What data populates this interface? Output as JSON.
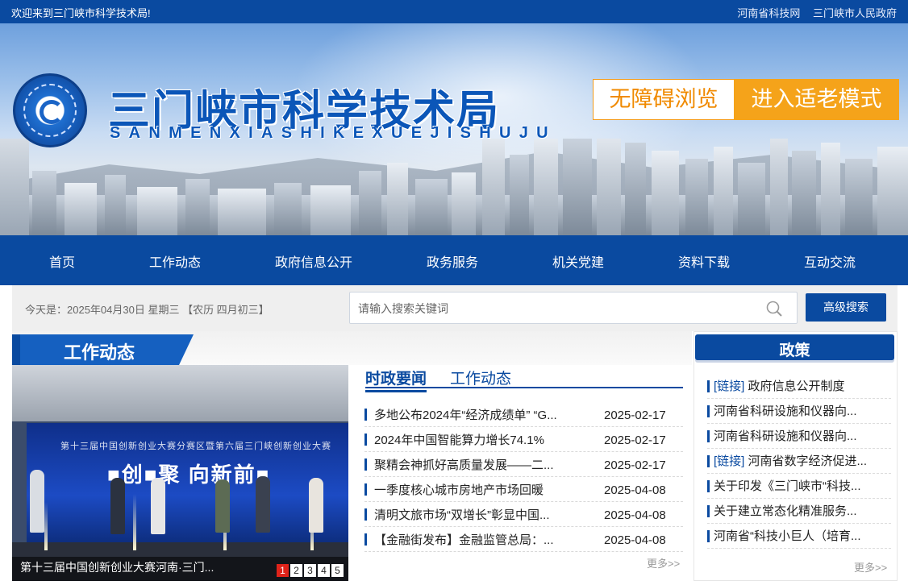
{
  "topbar": {
    "welcome": "欢迎来到三门峡市科学技术局!",
    "links": [
      "河南省科技网",
      "三门峡市人民政府"
    ]
  },
  "banner": {
    "title_cn": "三门峡市科学技术局",
    "title_en": "SANMENXIASHIKEXUEJISHUJU",
    "accessibility_label": "无障碍浏览",
    "elder_mode_label": "进入适老模式",
    "colors": {
      "primary": "#0a4aa0",
      "accent": "#f5a31a"
    }
  },
  "nav": {
    "items": [
      "首页",
      "工作动态",
      "政府信息公开",
      "政务服务",
      "机关党建",
      "资料下载",
      "互动交流"
    ]
  },
  "search": {
    "date_text": "今天是：2025年04月30日 星期三 【农历 四月初三】",
    "placeholder": "请输入搜索关键词",
    "value": "",
    "advanced_label": "高级搜索"
  },
  "work_section": {
    "title": "工作动态"
  },
  "carousel": {
    "screen_line1": "第十三届中国创新创业大赛分赛区暨第六届三门峡创新创业大赛",
    "screen_line2": "■创■聚 向新前■",
    "caption": "第十三届中国创新创业大赛河南·三门...",
    "pages": [
      "1",
      "2",
      "3",
      "4",
      "5"
    ],
    "active_page": "1"
  },
  "news": {
    "tabs": [
      "时政要闻",
      "工作动态"
    ],
    "active_tab": "时政要闻",
    "items": [
      {
        "title": "多地公布2024年“经济成绩单” “G...",
        "date": "2025-02-17"
      },
      {
        "title": "2024年中国智能算力增长74.1%",
        "date": "2025-02-17"
      },
      {
        "title": "聚精会神抓好高质量发展——二...",
        "date": "2025-02-17"
      },
      {
        "title": "一季度核心城市房地产市场回暖",
        "date": "2025-04-08"
      },
      {
        "title": "清明文旅市场“双增长”彰显中国...",
        "date": "2025-04-08"
      },
      {
        "title": "【金融街发布】金融监管总局：...",
        "date": "2025-04-08"
      }
    ],
    "more": "更多>>"
  },
  "policy": {
    "title": "政策",
    "items": [
      {
        "tag": "[链接]",
        "text": "政府信息公开制度"
      },
      {
        "tag": "",
        "text": "河南省科研设施和仪器向..."
      },
      {
        "tag": "",
        "text": "河南省科研设施和仪器向..."
      },
      {
        "tag": "[链接]",
        "text": "河南省数字经济促进..."
      },
      {
        "tag": "",
        "text": "关于印发《三门峡市“科技..."
      },
      {
        "tag": "",
        "text": "关于建立常态化精准服务..."
      },
      {
        "tag": "",
        "text": "河南省“科技小巨人（培育..."
      }
    ],
    "more": "更多>>"
  }
}
